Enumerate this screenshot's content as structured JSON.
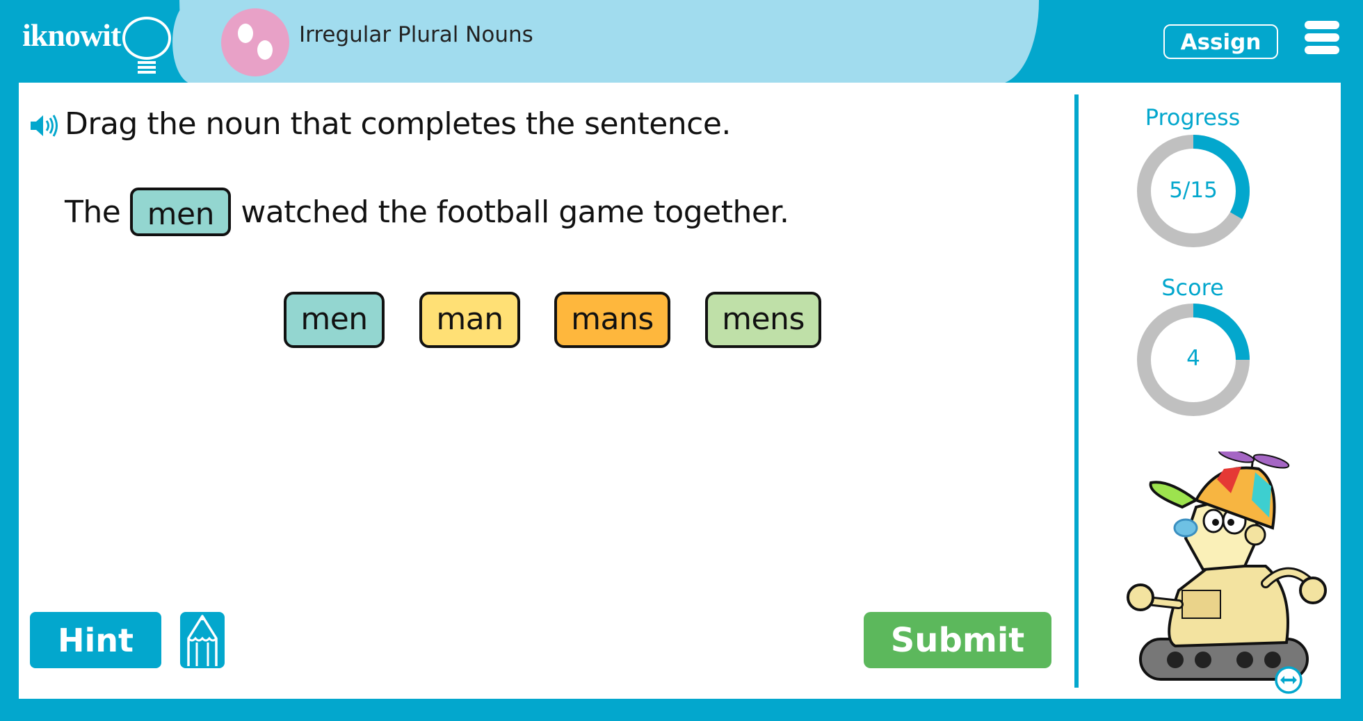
{
  "header": {
    "logo_text": "iknowit",
    "topic_title": "Irregular Plural Nouns",
    "assign_label": "Assign",
    "menu_icon": "hamburger-menu-icon"
  },
  "question": {
    "speaker_icon": "speaker-icon",
    "instruction": "Drag the noun that completes the sentence.",
    "sentence_before": "The",
    "sentence_slot": "men",
    "sentence_after": "watched the football game together.",
    "slot_color": "#93D6D0"
  },
  "choices": [
    {
      "label": "men",
      "color": "#93D6D0"
    },
    {
      "label": "man",
      "color": "#FFE075"
    },
    {
      "label": "mans",
      "color": "#FEB73D"
    },
    {
      "label": "mens",
      "color": "#BFE0A8"
    }
  ],
  "buttons": {
    "hint_label": "Hint",
    "pencil_icon": "pencil-icon",
    "submit_label": "Submit"
  },
  "sidebar": {
    "progress_label": "Progress",
    "progress_value": "5/15",
    "progress_fraction": 0.333,
    "score_label": "Score",
    "score_value": "4",
    "score_fraction": 0.25,
    "ring_track_color": "#C0C0C0",
    "ring_fill_color": "#03A7CD",
    "mascot": "robot-mascot",
    "resize_icon": "horizontal-resize-icon"
  },
  "colors": {
    "brand_blue": "#03A7CD",
    "title_panel": "#A1DCEE",
    "submit_green": "#5CB85C",
    "topic_icon_pink": "#E8A1C7"
  }
}
